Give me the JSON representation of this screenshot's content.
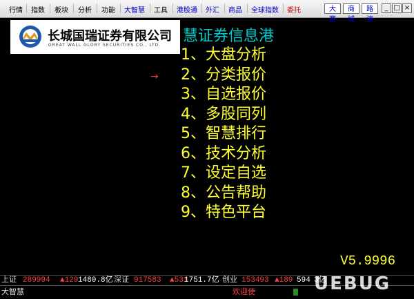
{
  "menubar": {
    "items": [
      "行情",
      "指数",
      "板块",
      "分析",
      "功能",
      "大智慧",
      "工具",
      "港股通",
      "外汇",
      "商品",
      "全球指数",
      "委托"
    ],
    "tabs": [
      "大赛",
      "商城",
      "路演"
    ],
    "window_buttons": [
      "_",
      "□",
      "×"
    ]
  },
  "logo": {
    "name_cn": "长城国瑞证券有限公司",
    "name_en": "GREAT WALL GLORY SECURITIES CO., LTD."
  },
  "main": {
    "title": "慧证券信息港",
    "options": [
      "1、大盘分析",
      "2、分类报价",
      "3、自选报价",
      "4、多股同列",
      "5、智慧排行",
      "6、技术分析",
      "7、设定自选",
      "8、公告帮助",
      "9、特色平台"
    ],
    "pointer": "→",
    "version": "V5.9996"
  },
  "status": {
    "sh_label": "上证",
    "sh_value": "289994",
    "sh_change": "▲129",
    "sh_amount": "1480.8亿",
    "sz_label": "深证",
    "sz_value": "917583",
    "sz_change": "▲531",
    "sz_amount": "1751.7亿",
    "cy_label": "创业",
    "cy_value": "153493",
    "cy_change": "▲189",
    "cy_amount": "594",
    "extra": "3亿",
    "app_name": "大智慧",
    "welcome": "欢迎使"
  },
  "watermark": "UEBUG",
  "colors": {
    "background": "#000000",
    "title": "#00cccc",
    "options": "#ffff33",
    "up": "#ff4040"
  }
}
